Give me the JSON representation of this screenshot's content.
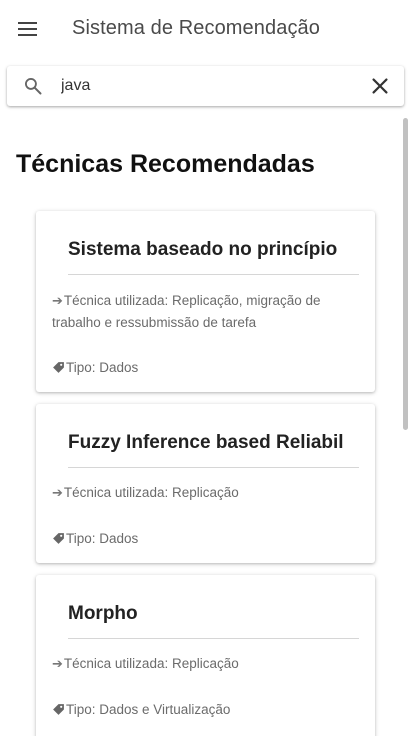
{
  "app_bar": {
    "title": "Sistema de Recomendação",
    "menu_icon": "menu-icon"
  },
  "search": {
    "value": "java",
    "search_icon": "search-icon",
    "clear_icon": "close-icon"
  },
  "section": {
    "title": "Técnicas Recomendadas"
  },
  "cards": [
    {
      "title": "Sistema baseado no princípio",
      "technique": "Técnica utilizada: Replicação, migração de trabalho e ressubmissão de tarefa",
      "type": "Tipo: Dados"
    },
    {
      "title": "Fuzzy Inference based Reliability",
      "technique": "Técnica utilizada: Replicação",
      "type": "Tipo: Dados"
    },
    {
      "title": "Morpho",
      "technique": "Técnica utilizada: Replicação",
      "type": "Tipo: Dados e Virtualização"
    }
  ]
}
